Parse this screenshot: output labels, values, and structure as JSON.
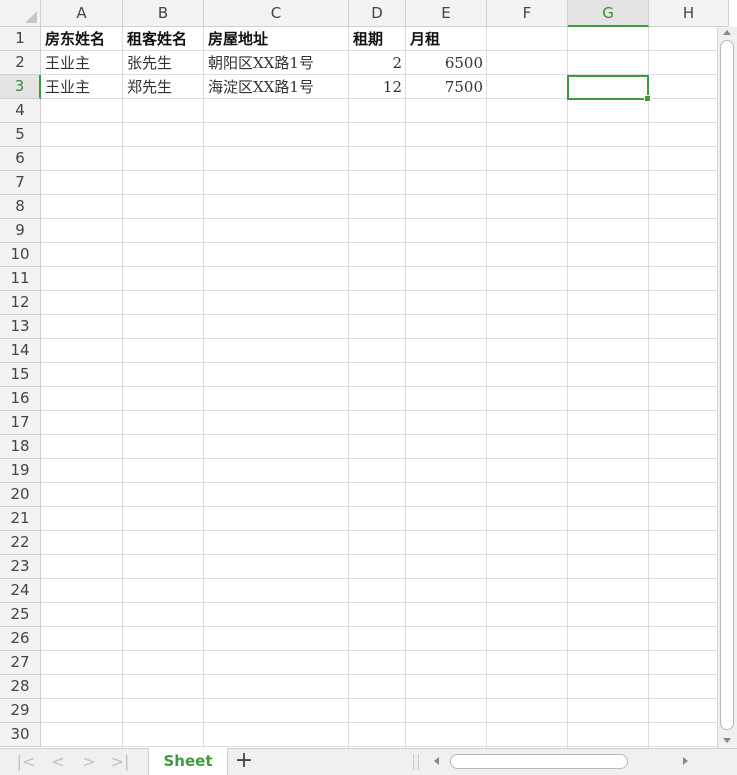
{
  "columns": [
    "A",
    "B",
    "C",
    "D",
    "E",
    "F",
    "G",
    "H"
  ],
  "selected_column": "G",
  "rows": [
    "1",
    "2",
    "3",
    "4",
    "5",
    "6",
    "7",
    "8",
    "9",
    "10",
    "11",
    "12",
    "13",
    "14",
    "15",
    "16",
    "17",
    "18",
    "19",
    "20",
    "21",
    "22",
    "23",
    "24",
    "25",
    "26",
    "27",
    "28",
    "29",
    "30"
  ],
  "selected_row": "3",
  "header_row": {
    "a": "房东姓名",
    "b": "租客姓名",
    "c": "房屋地址",
    "d": "租期",
    "e": "月租"
  },
  "data_rows": [
    {
      "a": "王业主",
      "b": "张先生",
      "c": "朝阳区XX路1号",
      "d": "2",
      "e": "6500"
    },
    {
      "a": "王业主",
      "b": "郑先生",
      "c": "海淀区XX路1号",
      "d": "12",
      "e": "7500"
    }
  ],
  "sheet_tab": "Sheet",
  "add_sheet": "+",
  "nav": {
    "first": "|<",
    "prev": "<",
    "next": ">",
    "last": ">|"
  },
  "colors": {
    "accent": "#3d9b3d",
    "grid": "#dcdcdc",
    "header_bg": "#f3f3f3"
  }
}
